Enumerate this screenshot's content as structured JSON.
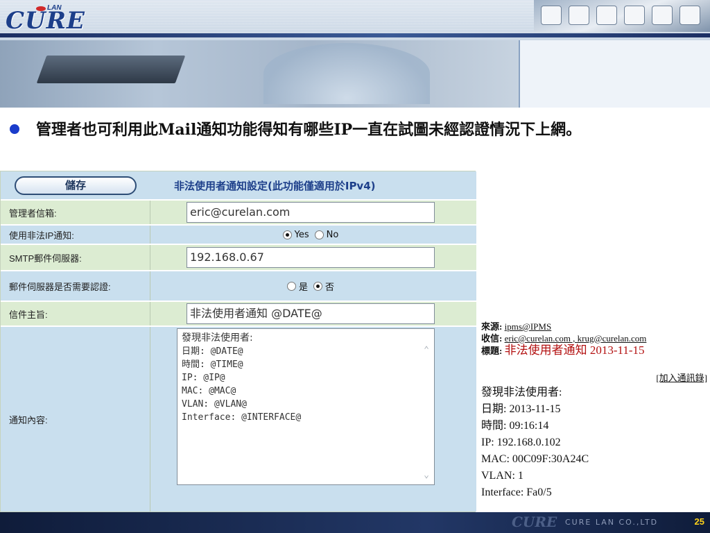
{
  "banner": {
    "logo_text": "CURE",
    "logo_sub": "LAN"
  },
  "heading": {
    "text": "管理者也可利用此Mail通知功能得知有哪些IP一直在試圖未經認證情況下上網。"
  },
  "form": {
    "save_label": "儲存",
    "title": "非法使用者通知設定(此功能僅適用於IPv4)",
    "admin_email": {
      "label": "管理者信箱:",
      "value": "eric@curelan.com"
    },
    "illegal_ip_notify": {
      "label": "使用非法IP通知:",
      "options": [
        "Yes",
        "No"
      ],
      "selected": "Yes"
    },
    "smtp_server": {
      "label": "SMTP郵件伺服器:",
      "value": "192.168.0.67"
    },
    "smtp_auth": {
      "label": "郵件伺服器是否需要認證:",
      "options": [
        "是",
        "否"
      ],
      "selected": "否"
    },
    "subject": {
      "label": "信件主旨:",
      "value": "非法使用者通知 @DATE@"
    },
    "content": {
      "label": "通知內容:",
      "lines": [
        "發現非法使用者:",
        "日期: @DATE@",
        "時間: @TIME@",
        "IP: @IP@",
        "MAC: @MAC@",
        "VLAN: @VLAN@",
        "Interface: @INTERFACE@"
      ]
    }
  },
  "email_preview": {
    "from_label": "來源:",
    "from_value": "ipms@IPMS",
    "to_label": "收信:",
    "to_value": "eric@curelan.com , krug@curelan.com",
    "subject_label": "標題:",
    "subject_value": "非法使用者通知 2013-11-15",
    "add_contacts": "[加入通訊錄]",
    "body_lines": [
      "發現非法使用者:",
      "日期: 2013-11-15",
      "時間: 09:16:14",
      "IP: 192.168.0.102",
      "MAC: 00C09F:30A24C",
      "VLAN: 1",
      "Interface: Fa0/5"
    ]
  },
  "footer": {
    "logo_text": "CURE",
    "company": "CURE LAN CO.,LTD",
    "page_number": "25"
  }
}
